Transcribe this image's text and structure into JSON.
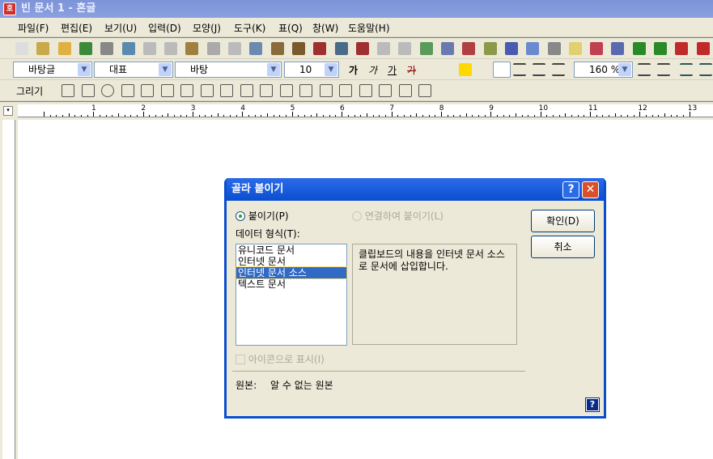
{
  "window": {
    "title": "빈 문서 1 - 혼글",
    "app_icon": "hangul-logo-icon"
  },
  "menu": [
    "파일(F)",
    "편집(E)",
    "보기(U)",
    "입력(D)",
    "모양(J)",
    "도구(K)",
    "표(Q)",
    "창(W)",
    "도움말(H)"
  ],
  "toolbar1_icons": [
    "new-doc-icon",
    "open-template-icon",
    "open-folder-icon",
    "save-icon",
    "print-icon",
    "preview-icon",
    "undo-icon",
    "redo-icon",
    "find-icon",
    "cut-icon",
    "copy-icon",
    "paste-icon",
    "stamp-icon",
    "spell-icon",
    "paragraph-icon",
    "char-shape-icon",
    "list-style-icon",
    "link-icon",
    "unlink-icon",
    "picture-icon",
    "table-icon",
    "chart-icon",
    "draw-icon",
    "formula-icon",
    "abc-icon",
    "seal-icon",
    "memo-icon",
    "book-icon",
    "presentation-icon",
    "macro1-play-icon",
    "macro2-play-icon",
    "macro1-record-icon",
    "macro2-record-icon"
  ],
  "toolbar2": {
    "style": "바탕글",
    "lang": "대표",
    "font": "바탕",
    "size": "10",
    "line_spacing": "160 %",
    "bold": "가",
    "italic": "가",
    "underline": "가",
    "strike": "가"
  },
  "toolbar3": {
    "draw_label": "그리기"
  },
  "ruler": [
    "1",
    "2",
    "3",
    "4",
    "5",
    "6",
    "7",
    "8",
    "9",
    "10",
    "11",
    "12",
    "13"
  ],
  "dialog": {
    "title": "골라 붙이기",
    "radio_paste": "붙이기(P)",
    "radio_link": "연결하여 붙이기(L)",
    "format_label": "데이터 형식(T):",
    "formats": [
      "유니코드 문서",
      "인터넷 문서",
      "인터넷 문서 소스",
      "텍스트 문서"
    ],
    "selected_index": 2,
    "description": "클립보드의 내용을 인터넷 문서 소스로 문서에 삽입합니다.",
    "checkbox_icon": "아이콘으로 표시(I)",
    "source_label": "원본:",
    "source_value": "알 수 없는 원본",
    "ok": "확인(D)",
    "cancel": "취소",
    "help": "?",
    "close": "✕"
  }
}
